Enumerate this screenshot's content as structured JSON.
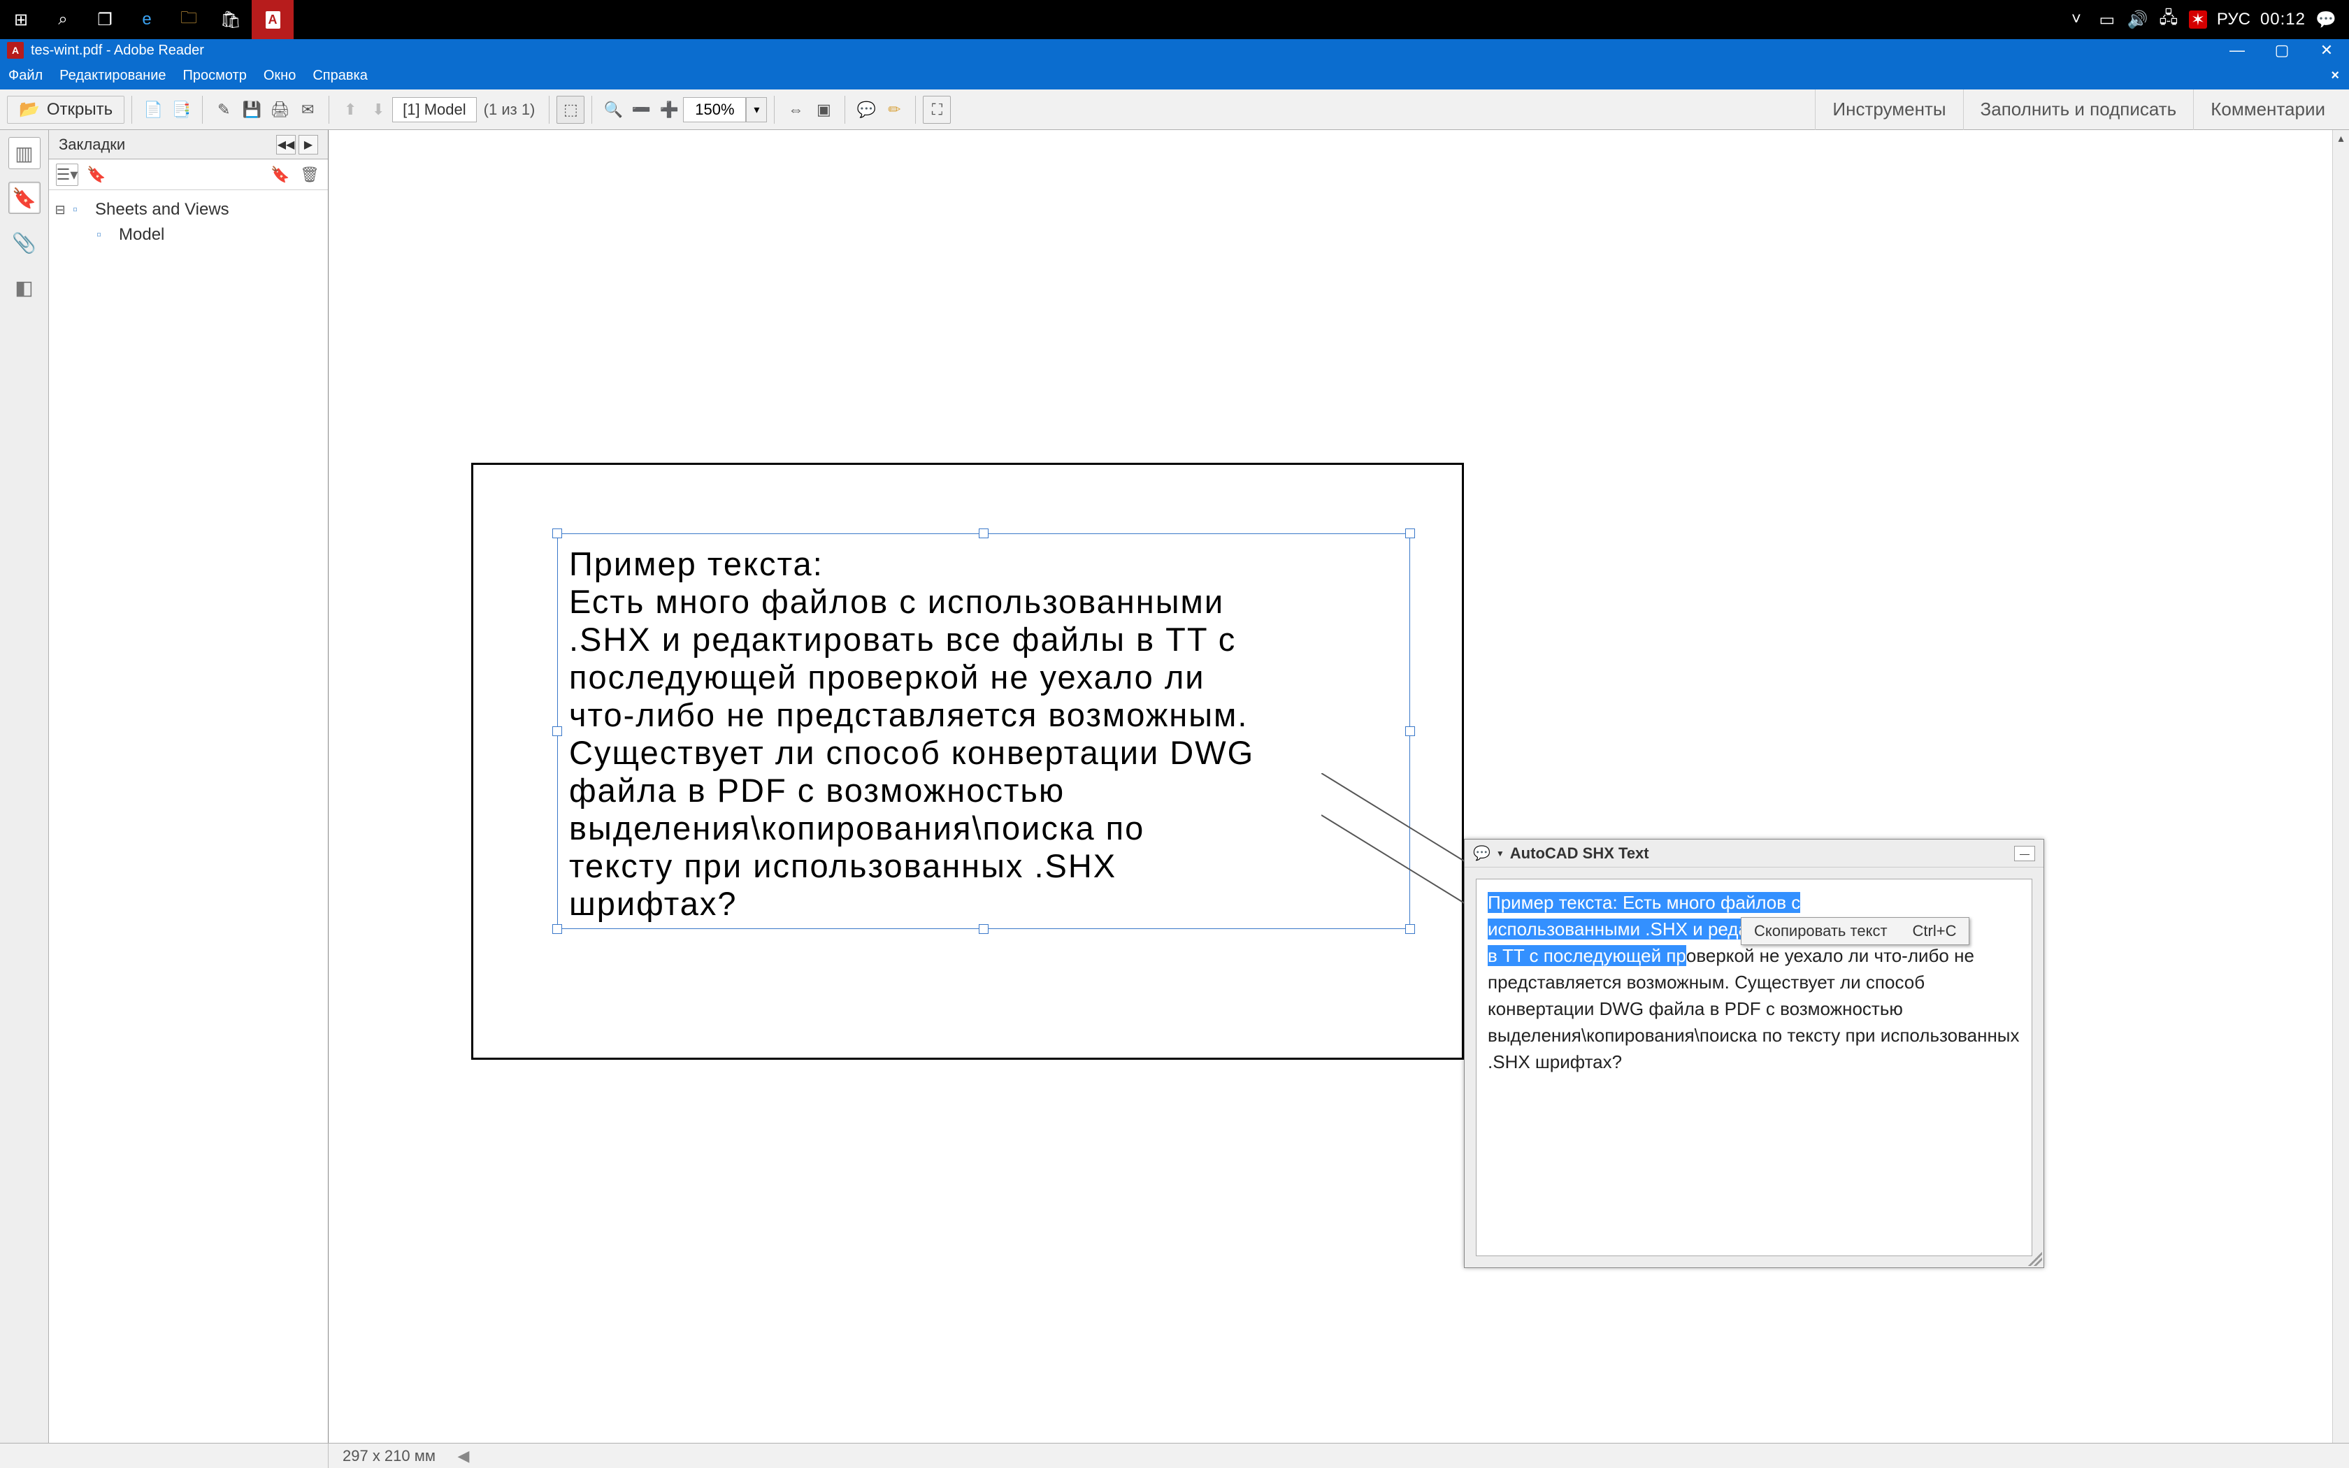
{
  "taskbar": {
    "lang": "РУС",
    "time": "00:12"
  },
  "window": {
    "title": "tes-wint.pdf - Adobe Reader",
    "menu": {
      "file": "Файл",
      "edit": "Редактирование",
      "view": "Просмотр",
      "window": "Окно",
      "help": "Справка"
    }
  },
  "toolbar": {
    "open_label": "Открыть",
    "page_label": "[1] Model",
    "page_count": "(1 из 1)",
    "zoom_value": "150%",
    "right": {
      "tools": "Инструменты",
      "fillsign": "Заполнить и подписать",
      "comments": "Комментарии"
    }
  },
  "bookmarks": {
    "title": "Закладки",
    "items": [
      {
        "label": "Sheets and Views",
        "children": [
          {
            "label": "Model"
          }
        ]
      }
    ]
  },
  "document": {
    "text_line1": "Пример текста:",
    "text_line2": "Есть много файлов с использованными",
    "text_line3": ".SHX и редактировать все файлы в TT с",
    "text_line4": "последующей проверкой не уехало ли",
    "text_line5": "что-либо не представляется возможным.",
    "text_line6": "Существует ли способ конвертации DWG",
    "text_line7": "файла в PDF с возможностью",
    "text_line8": "выделения\\копирования\\поиска по",
    "text_line9": "тексту при использованных .SHX",
    "text_line10": "шрифтах?"
  },
  "popup": {
    "title": "AutoCAD SHX Text",
    "sel1": "Пример текста: Есть много файлов с",
    "sel2": "использованными .SHX и редактировать все файлы",
    "sel3a": "в TT с последующей пр",
    "rest3b": "оверкой не уехало ли что-",
    "rest4": "либо не представляется возможным. Существует ли способ конвертации DWG файла в PDF c возможностью выделения\\копирования\\поиска по тексту при использованных .SHX шрифтах?",
    "context": {
      "label": "Скопировать текст",
      "key": "Ctrl+C"
    }
  },
  "status": {
    "page_size": "297 x 210 мм"
  }
}
